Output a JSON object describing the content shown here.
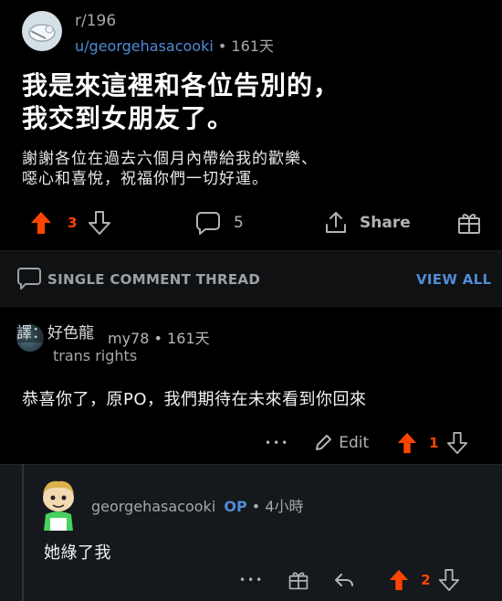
{
  "post": {
    "subreddit": "r/196",
    "author": "u/georgehasacooki",
    "separator": "•",
    "age": "161天",
    "title_line1": "我是來這裡和各位告別的，",
    "title_line2": "我交到女朋友了。",
    "body_line1": "謝謝各位在過去六個月內帶給我的歡樂、",
    "body_line2": "噁心和喜悅，祝福你們一切好運。",
    "upvotes": "3",
    "comments": "5",
    "share_label": "Share"
  },
  "thread": {
    "label": "SINGLE COMMENT THREAD",
    "view_all": "VIEW ALL"
  },
  "comment1": {
    "translator_note": "譯：好色龍",
    "username": "my78",
    "separator": "•",
    "age": "161天",
    "flair": "trans rights",
    "body": "恭喜你了，原PO，我們期待在未來看到你回來",
    "more": "•••",
    "edit_label": "Edit",
    "votes": "1"
  },
  "comment2": {
    "username": "georgehasacooki",
    "op_badge": "OP",
    "separator": "•",
    "age": "4小時",
    "body": "她綠了我",
    "more": "•••",
    "votes": "2"
  },
  "colors": {
    "upvote": "#ff4500",
    "link": "#4f8bd6",
    "background": "#000000",
    "reply_background": "#15181c"
  }
}
